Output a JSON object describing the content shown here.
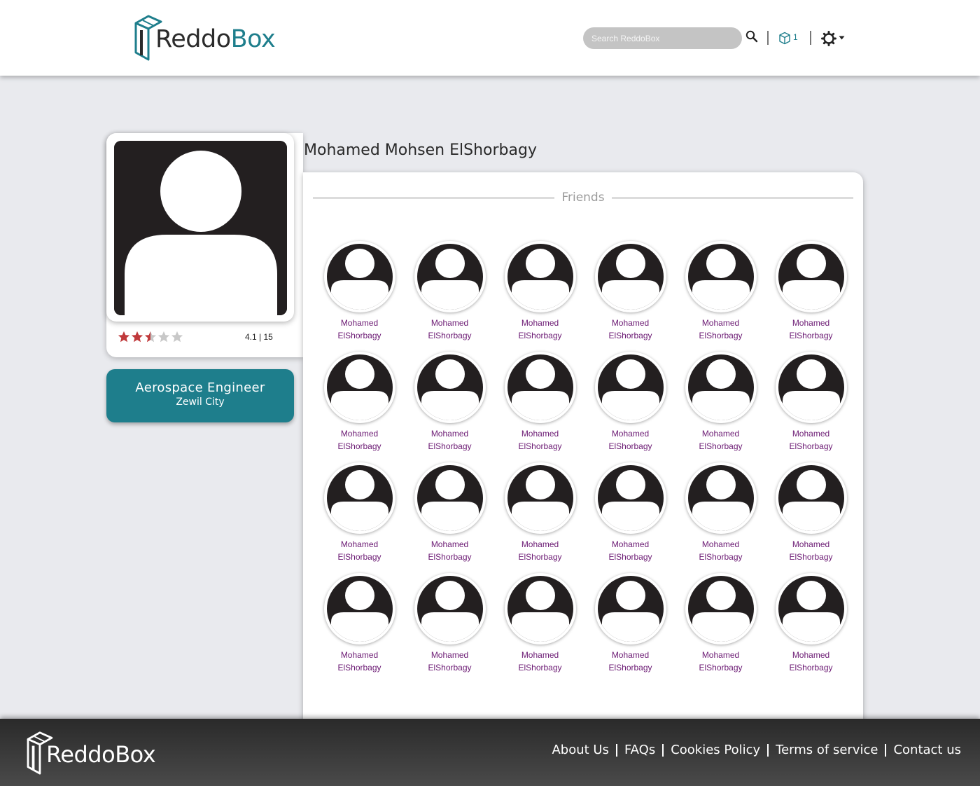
{
  "header": {
    "logo_reddo": "Reddo",
    "logo_box": "Box",
    "search_placeholder": "Search ReddoBox",
    "box_count": "1"
  },
  "profile": {
    "name": "Mohamed Mohsen ElShorbagy",
    "rating": 2.5,
    "rating_text": "4.1 | 15",
    "job_title": "Aerospace Engineer",
    "job_place": "Zewil City"
  },
  "friends": {
    "heading": "Friends",
    "items": [
      {
        "first": "Mohamed",
        "last": "ElShorbagy"
      },
      {
        "first": "Mohamed",
        "last": "ElShorbagy"
      },
      {
        "first": "Mohamed",
        "last": "ElShorbagy"
      },
      {
        "first": "Mohamed",
        "last": "ElShorbagy"
      },
      {
        "first": "Mohamed",
        "last": "ElShorbagy"
      },
      {
        "first": "Mohamed",
        "last": "ElShorbagy"
      },
      {
        "first": "Mohamed",
        "last": "ElShorbagy"
      },
      {
        "first": "Mohamed",
        "last": "ElShorbagy"
      },
      {
        "first": "Mohamed",
        "last": "ElShorbagy"
      },
      {
        "first": "Mohamed",
        "last": "ElShorbagy"
      },
      {
        "first": "Mohamed",
        "last": "ElShorbagy"
      },
      {
        "first": "Mohamed",
        "last": "ElShorbagy"
      },
      {
        "first": "Mohamed",
        "last": "ElShorbagy"
      },
      {
        "first": "Mohamed",
        "last": "ElShorbagy"
      },
      {
        "first": "Mohamed",
        "last": "ElShorbagy"
      },
      {
        "first": "Mohamed",
        "last": "ElShorbagy"
      },
      {
        "first": "Mohamed",
        "last": "ElShorbagy"
      },
      {
        "first": "Mohamed",
        "last": "ElShorbagy"
      },
      {
        "first": "Mohamed",
        "last": "ElShorbagy"
      },
      {
        "first": "Mohamed",
        "last": "ElShorbagy"
      },
      {
        "first": "Mohamed",
        "last": "ElShorbagy"
      },
      {
        "first": "Mohamed",
        "last": "ElShorbagy"
      },
      {
        "first": "Mohamed",
        "last": "ElShorbagy"
      },
      {
        "first": "Mohamed",
        "last": "ElShorbagy"
      }
    ]
  },
  "footer": {
    "logo_reddo": "Reddo",
    "logo_box": "Box",
    "links": [
      "About Us",
      "FAQs",
      "Cookies Policy",
      "Terms of service",
      "Contact us"
    ]
  },
  "colors": {
    "brand_teal": "#1e7e8c",
    "friend_name": "#6b1a73",
    "star_filled": "#c0393b",
    "star_empty": "#c8c8c8"
  },
  "icons": [
    "reddobox-logo-icon",
    "search-icon",
    "box-icon",
    "gear-icon",
    "chevron-down-icon",
    "star-icon",
    "user-avatar-icon"
  ]
}
